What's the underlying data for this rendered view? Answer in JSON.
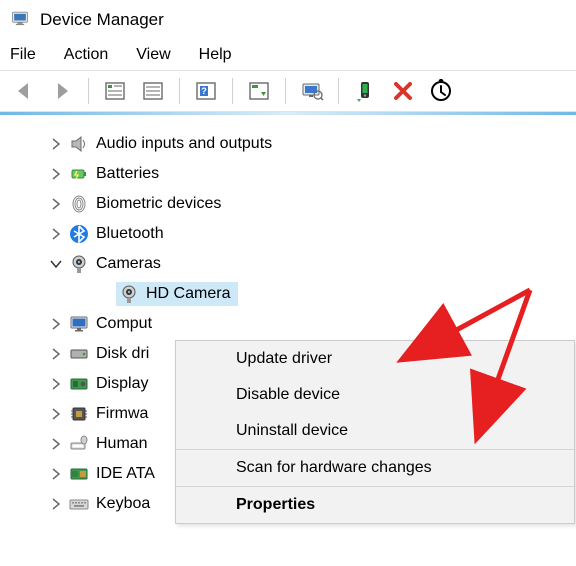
{
  "title": "Device Manager",
  "menu": {
    "file": "File",
    "action": "Action",
    "view": "View",
    "help": "Help"
  },
  "tree": {
    "audio": "Audio inputs and outputs",
    "batteries": "Batteries",
    "biometric": "Biometric devices",
    "bluetooth": "Bluetooth",
    "cameras": "Cameras",
    "hd_camera": "HD Camera",
    "computers": "Comput",
    "disk": "Disk dri",
    "display": "Display",
    "firmware": "Firmwa",
    "human": "Human",
    "ide": "IDE ATA",
    "keyboards": "Keyboa"
  },
  "context_menu": {
    "update": "Update driver",
    "disable": "Disable device",
    "uninstall": "Uninstall device",
    "scan": "Scan for hardware changes",
    "properties": "Properties"
  }
}
